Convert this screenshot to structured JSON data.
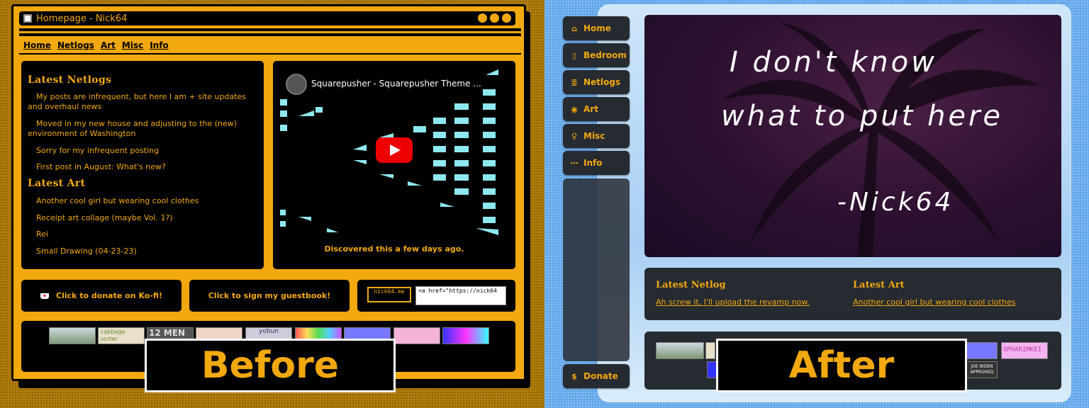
{
  "before": {
    "title": "Homepage - Nick64",
    "nav": [
      "Home",
      "Netlogs",
      "Art",
      "Misc",
      "Info"
    ],
    "netlogs_heading": "Latest Netlogs",
    "netlogs": [
      "My posts are infrequent, but here I am + site updates and overhaul news",
      "Moved in my new house and adjusting to the (new) environment of Washington",
      "Sorry for my infrequent posting",
      "First post in August: What's new?"
    ],
    "art_heading": "Latest Art",
    "art": [
      "Another cool girl but wearing cool clothes",
      "Receipt art collage (maybe Vol. 1?)",
      "Rei",
      "Small Drawing (04-23-23)"
    ],
    "video_title": "Squarepusher - Squarepusher Theme ...",
    "video_caption": "Discovered this a few days ago.",
    "donate": "Click to donate on Ko-fi!",
    "guestbook": "Click to sign my guestbook!",
    "button_code": "<a href=\"https://nick64",
    "nick_badge": "nick64.me",
    "badge_texts": [
      "cabbage sorter",
      "12 MEN",
      "yobun"
    ],
    "label": "Before"
  },
  "after": {
    "sidebar": [
      {
        "label": "Home",
        "icon": "home-icon",
        "glyph": "⌂"
      },
      {
        "label": "Bedroom",
        "icon": "door-icon",
        "glyph": "▯"
      },
      {
        "label": "Netlogs",
        "icon": "notebook-icon",
        "glyph": "≣"
      },
      {
        "label": "Art",
        "icon": "palette-icon",
        "glyph": "◉"
      },
      {
        "label": "Misc",
        "icon": "lightbulb-icon",
        "glyph": "♀"
      },
      {
        "label": "Info",
        "icon": "ellipsis-icon",
        "glyph": "⋯"
      }
    ],
    "donate": {
      "label": "Donate",
      "glyph": "$"
    },
    "hero_lines": [
      "I  don't  know",
      "what  to  put  here",
      "-Nick64"
    ],
    "netlog_heading": "Latest Netlog",
    "netlog_link": "Ah screw it, I'll upload the revamp now.",
    "art_heading": "Latest Art",
    "art_link": "Another cool girl but wearing cool clothes",
    "badge_texts": [
      "JOE BIDEN APPROVED",
      "OPHARIMKEI"
    ],
    "label": "After"
  }
}
